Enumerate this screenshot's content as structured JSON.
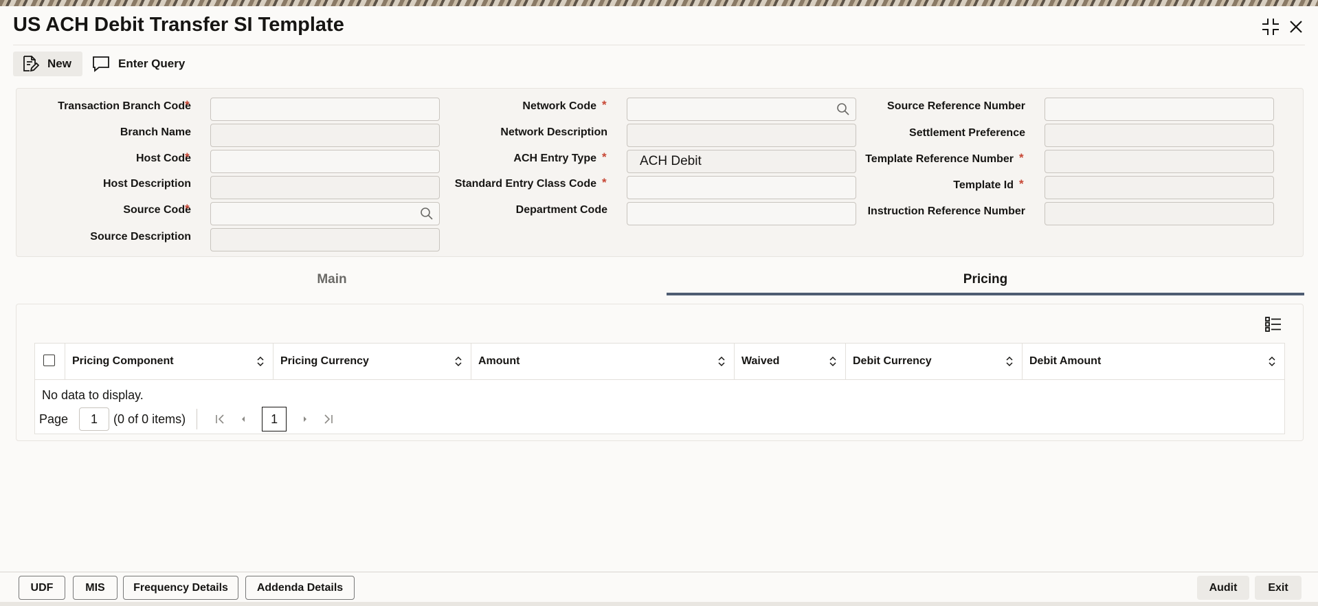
{
  "window": {
    "title": "US ACH Debit Transfer SI Template",
    "icons": [
      "collapse-icon",
      "close-icon"
    ]
  },
  "toolbar": {
    "new_label": "New",
    "enter_query_label": "Enter Query"
  },
  "form": {
    "transaction_branch_code": {
      "label": "Transaction Branch Code",
      "required": "*",
      "value": ""
    },
    "branch_name": {
      "label": "Branch Name",
      "value": ""
    },
    "host_code": {
      "label": "Host Code",
      "required": "*",
      "value": ""
    },
    "host_description": {
      "label": "Host Description",
      "value": ""
    },
    "source_code": {
      "label": "Source Code",
      "required": "*",
      "value": ""
    },
    "source_description": {
      "label": "Source Description",
      "value": ""
    },
    "network_code": {
      "label": "Network Code",
      "required": "*",
      "value": ""
    },
    "network_description": {
      "label": "Network Description",
      "value": ""
    },
    "ach_entry_type": {
      "label": "ACH Entry Type",
      "required": "*",
      "value": "ACH Debit"
    },
    "standard_entry_class_code": {
      "label": "Standard Entry Class Code",
      "required": "*",
      "value": ""
    },
    "department_code": {
      "label": "Department Code",
      "value": ""
    },
    "source_reference_number": {
      "label": "Source Reference Number",
      "value": ""
    },
    "settlement_preference": {
      "label": "Settlement Preference",
      "value": ""
    },
    "template_reference_number": {
      "label": "Template Reference Number",
      "required": "*",
      "value": ""
    },
    "template_id": {
      "label": "Template Id",
      "required": "*",
      "value": ""
    },
    "instruction_reference_number": {
      "label": "Instruction Reference Number",
      "value": ""
    }
  },
  "tabs": {
    "main": "Main",
    "pricing": "Pricing",
    "active": "Pricing"
  },
  "pricing_table": {
    "columns": [
      "Pricing Component",
      "Pricing Currency",
      "Amount",
      "Waived",
      "Debit Currency",
      "Debit Amount"
    ],
    "rows": [],
    "empty_text": "No data to display.",
    "pager": {
      "page_label": "Page",
      "page_value": "1",
      "items_text": "(0 of 0 items)",
      "current_page": "1"
    }
  },
  "footer": {
    "udf": "UDF",
    "mis": "MIS",
    "frequency_details": "Frequency Details",
    "addenda_details": "Addenda Details",
    "audit": "Audit",
    "exit": "Exit"
  },
  "colors": {
    "required": "#c74634",
    "tab_underline": "#4f5d73"
  }
}
